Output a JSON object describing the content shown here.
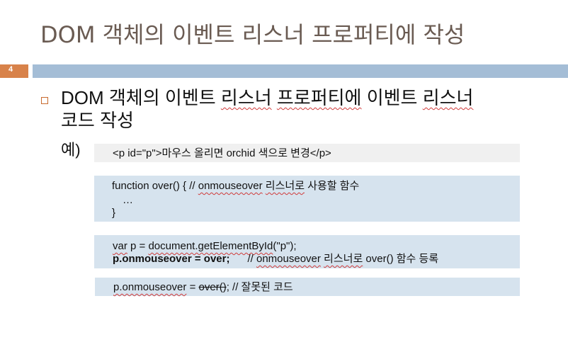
{
  "slide": {
    "title": "DOM 객체의 이벤트 리스너 프로퍼티에 작성",
    "page_number": "4",
    "bullet": {
      "part1": "DOM 객체의 이벤트 ",
      "part2": "리스너",
      "part3": " ",
      "part4": "프로퍼티에",
      "part5": " 이벤트 ",
      "part6": "리스너",
      "line2": "코드 작성"
    },
    "example_label": "예)",
    "code_box1": {
      "line1": "<p id=\"p\">마우스 올리면 orchid 색으로 변경</p>"
    },
    "code_box2": {
      "line1_a": "function over() { // ",
      "line1_b": "onmouseover",
      "line1_c": " ",
      "line1_d": "리스너로",
      "line1_e": " 사용할 함수",
      "line2": "…",
      "line3": "}"
    },
    "code_box3": {
      "line1_a": "var",
      "line1_b": " p = ",
      "line1_c": "document.getElementById",
      "line1_d": "(\"p\");",
      "line2_a": "p.onmouseover = over;",
      "line2_b": "      // ",
      "line2_c": "onmouseover",
      "line2_d": " ",
      "line2_e": "리스너로",
      "line2_f": " over() 함수 등록"
    },
    "code_box4": {
      "line1_a": "p.onmouseover",
      "line1_b": " = ",
      "line1_c": "over()",
      "line1_d": "; // 잘못된 코드"
    }
  }
}
